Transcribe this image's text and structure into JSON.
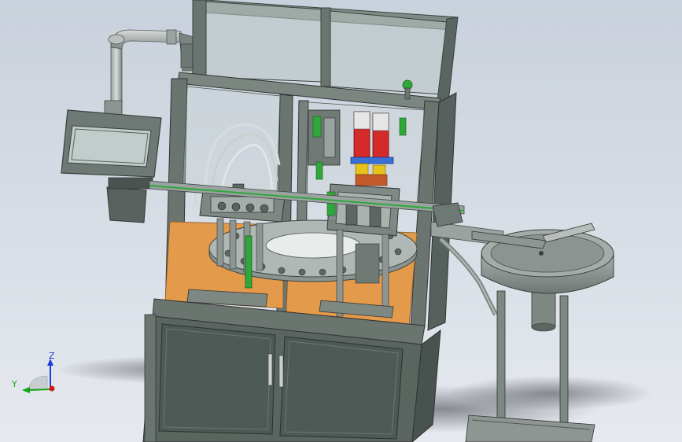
{
  "viewport": {
    "background_top": "#c9d1dc",
    "background_bottom": "#e6e9ef"
  },
  "triad": {
    "z_label": "Z",
    "y_label": "Y",
    "z_color": "#1a3ed8",
    "y_color": "#17a317",
    "x_color": "#d11a1a"
  },
  "machine": {
    "frame_color": "#5c6860",
    "frame_dark": "#3f4a44",
    "glass_color": "#b7c4c4",
    "base_plate_color": "#e39a4a",
    "panel_color": "#4e5a55",
    "accent_red": "#d42a2a",
    "accent_yellow": "#e6c21a",
    "accent_blue": "#3a6fd6",
    "accent_green": "#2fa83a",
    "bowl_color": "#8f9693"
  }
}
